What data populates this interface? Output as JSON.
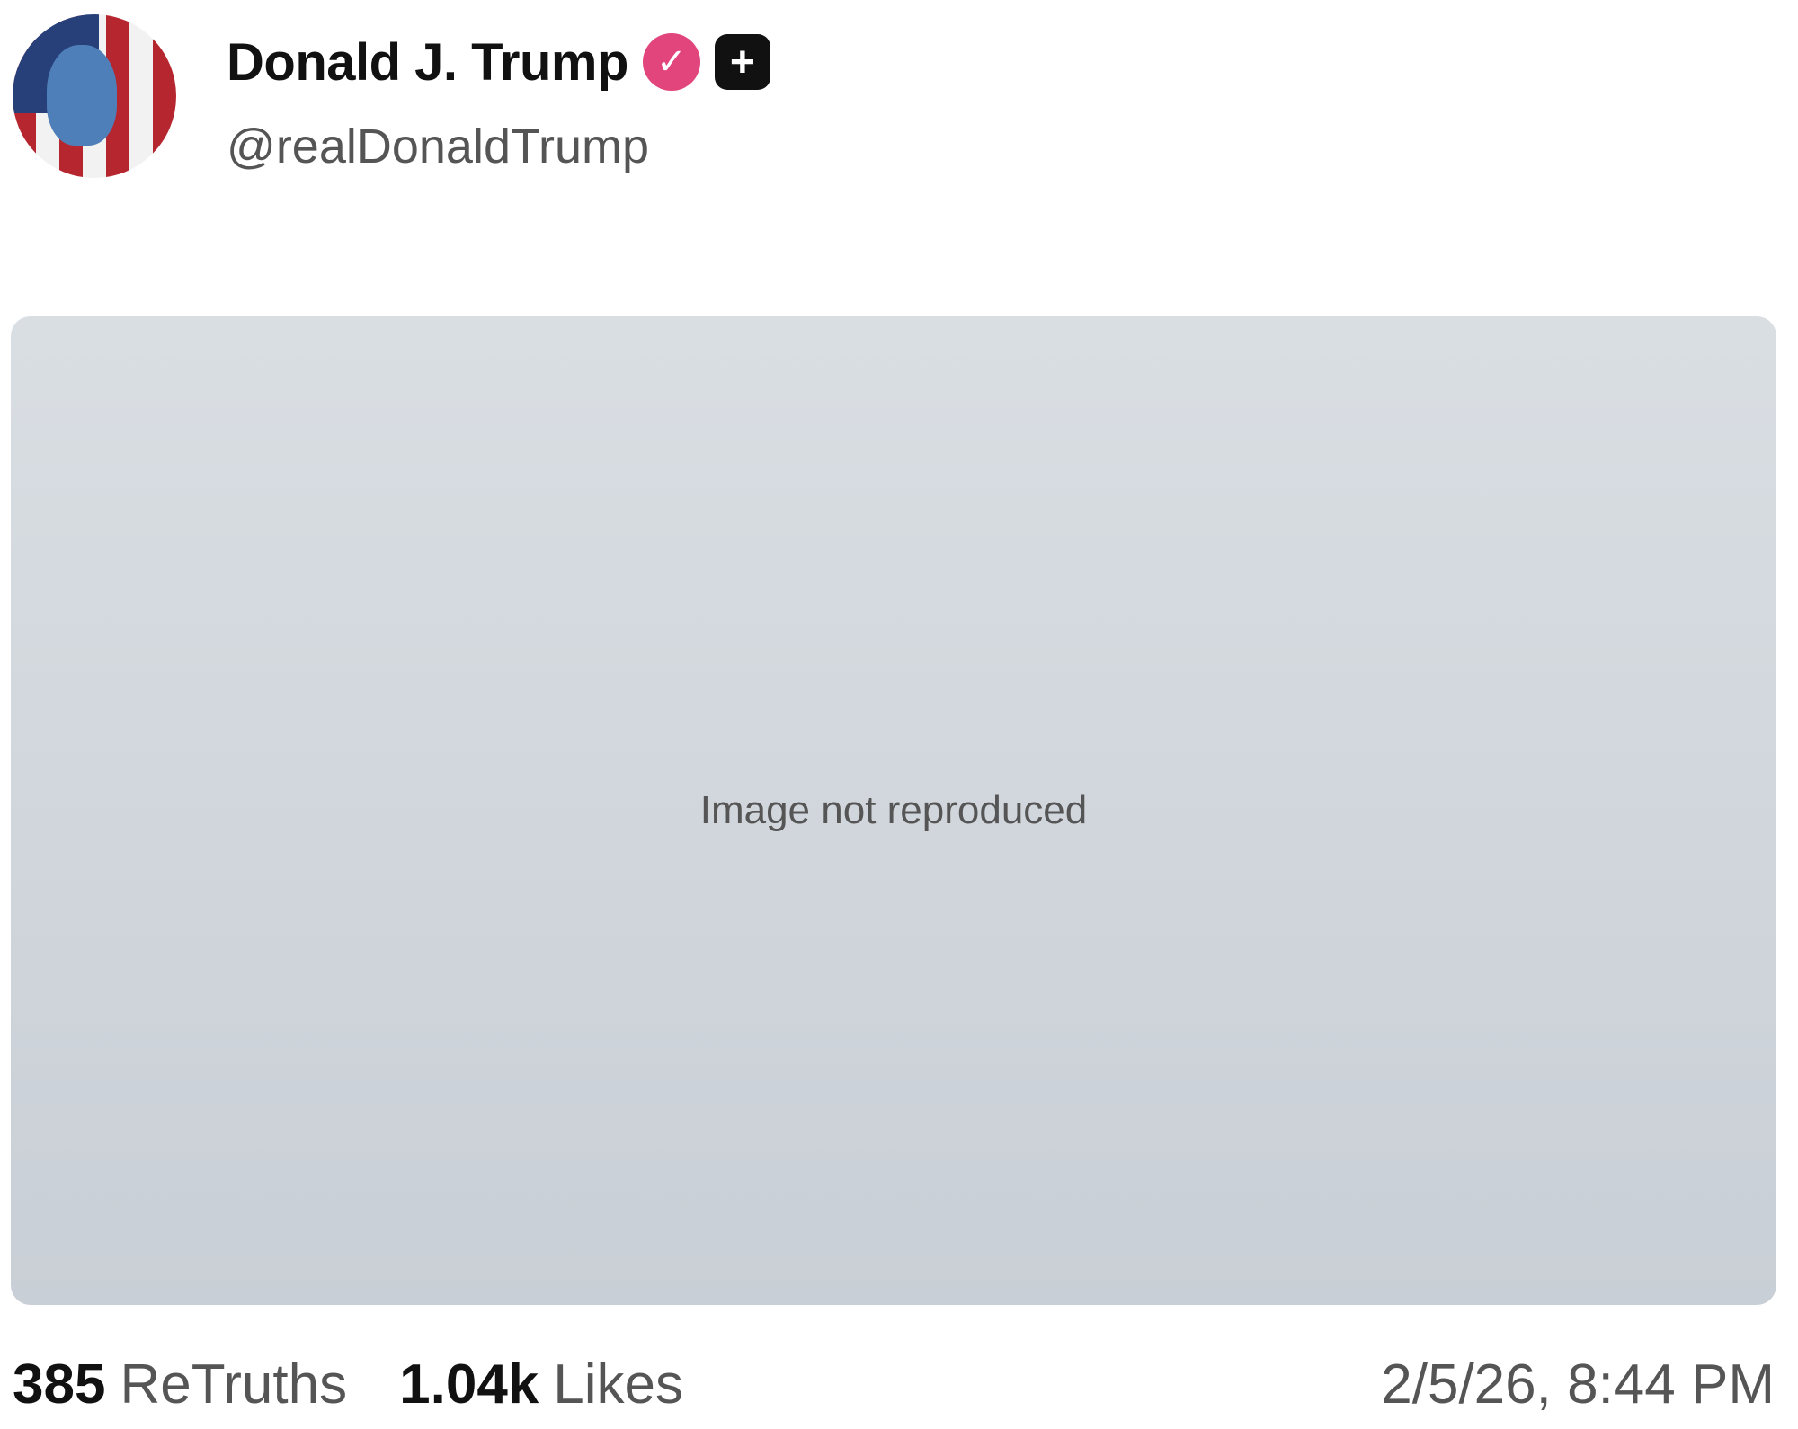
{
  "author": {
    "display_name": "Donald J. Trump",
    "verified_icon": "verified-check-icon",
    "plus_icon": "plus-square-icon",
    "handle": "@realDonaldTrump"
  },
  "media": {
    "type": "image",
    "note": "Image not reproduced"
  },
  "stats": {
    "retruths_count": "385",
    "retruths_label": "ReTruths",
    "likes_count": "1.04k",
    "likes_label": "Likes"
  },
  "timestamp": "2/5/26, 8:44 PM",
  "colors": {
    "verified_badge": "#e2457b",
    "muted_text": "#555555"
  }
}
